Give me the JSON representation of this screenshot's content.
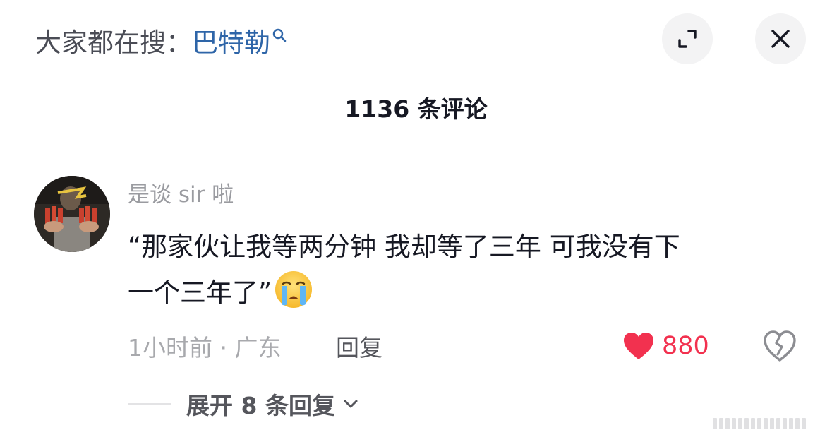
{
  "header": {
    "search_prefix": "大家都在搜：",
    "search_keyword": "巴特勒",
    "search_icon": "search-icon",
    "expand_icon": "expand-icon",
    "close_icon": "close-icon"
  },
  "comments_header": {
    "count_text": "1136 条评论"
  },
  "comment": {
    "username": "是谈 sir 啦",
    "text_line1": "“那家伙让我等两分钟 我却等了三年 可我没有下",
    "text_line2": "一个三年了”",
    "emoji": "crying-emoji",
    "time_location": "1小时前 · 广东",
    "reply_label": "回复",
    "like_count": "880",
    "liked": true,
    "like_color": "#f2314f"
  },
  "replies": {
    "expand_label": "展开 8 条回复"
  }
}
